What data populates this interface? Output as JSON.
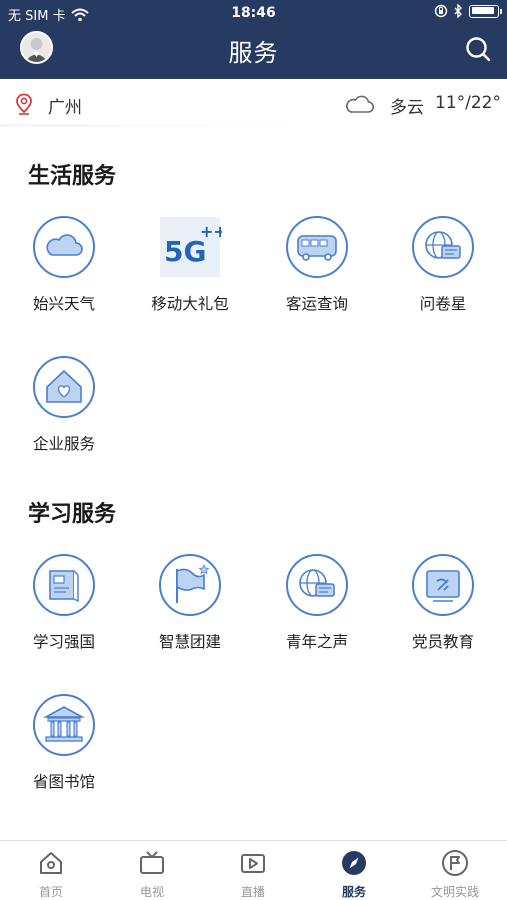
{
  "status_bar": {
    "carrier": "无 SIM 卡",
    "time": "18:46"
  },
  "header": {
    "title": "服务"
  },
  "location": {
    "city": "广州",
    "weather": "多云",
    "temperature": "11°/22°"
  },
  "sections": [
    {
      "title": "生活服务",
      "items": [
        {
          "label": "始兴天气",
          "icon": "cloud-icon"
        },
        {
          "label": "移动大礼包",
          "icon": "5g-icon"
        },
        {
          "label": "客运查询",
          "icon": "bus-icon"
        },
        {
          "label": "问卷星",
          "icon": "globe-chat-icon"
        },
        {
          "label": "企业服务",
          "icon": "house-heart-icon"
        }
      ]
    },
    {
      "title": "学习服务",
      "items": [
        {
          "label": "学习强国",
          "icon": "book-flag-icon"
        },
        {
          "label": "智慧团建",
          "icon": "flag-icon"
        },
        {
          "label": "青年之声",
          "icon": "globe-chat-icon"
        },
        {
          "label": "党员教育",
          "icon": "party-flag-icon"
        },
        {
          "label": "省图书馆",
          "icon": "library-icon"
        }
      ]
    }
  ],
  "tabbar": [
    {
      "label": "首页",
      "icon": "home-icon"
    },
    {
      "label": "电视",
      "icon": "tv-icon"
    },
    {
      "label": "直播",
      "icon": "live-icon"
    },
    {
      "label": "服务",
      "icon": "compass-icon",
      "active": true
    },
    {
      "label": "文明实践",
      "icon": "flag-circle-icon"
    }
  ],
  "colors": {
    "header_bg": "#263a62",
    "icon_blue": "#4a7fd0",
    "icon_fill": "#bcd3f2"
  }
}
